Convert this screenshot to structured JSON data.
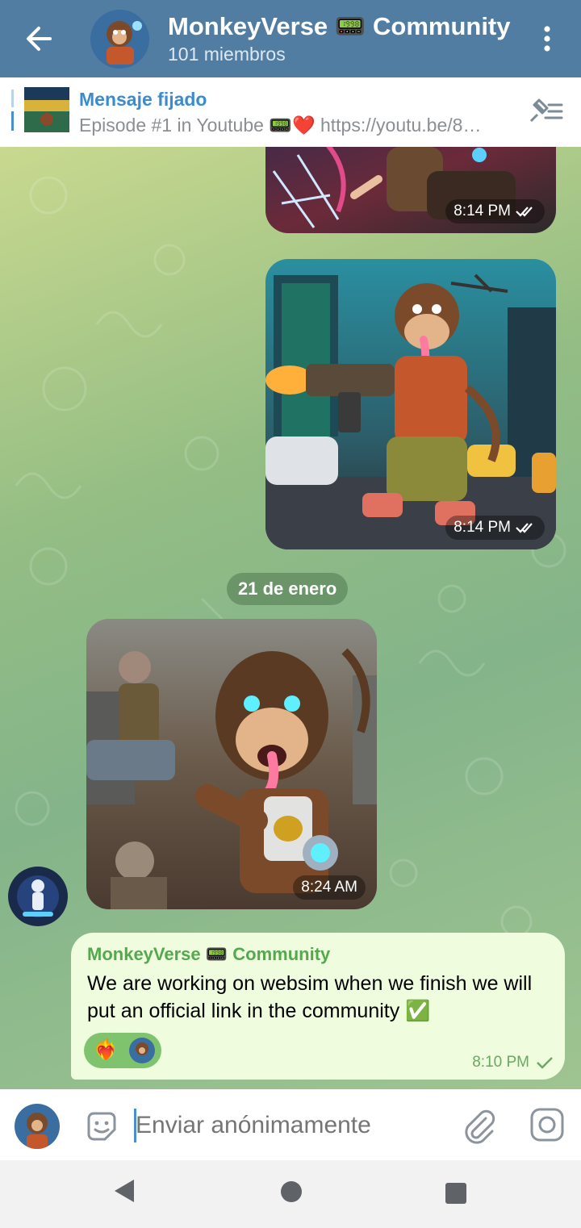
{
  "header": {
    "title": "MonkeyVerse 📟 Community",
    "subtitle": "101 miembros",
    "accent": "#517da2"
  },
  "pinned": {
    "title": "Mensaje fijado",
    "text": "Episode #1 in Youtube 📟❤️  https://youtu.be/8…"
  },
  "messages": {
    "photo1_time": "8:14 PM",
    "photo2_time": "8:14 PM",
    "date_divider": "21 de enero",
    "photo3_time": "8:24 AM",
    "text_message": {
      "sender": "MonkeyVerse 📟 Community",
      "text": "We are working on websim when we finish we will put an official link in the community ✅",
      "reaction": "❤️‍🔥",
      "time": "8:10 PM"
    }
  },
  "input": {
    "placeholder": "Enviar anónimamente"
  },
  "icons": {
    "back": "arrow-left-icon",
    "more": "more-vertical-icon",
    "unpin": "unpin-list-icon",
    "sticker": "sticker-icon",
    "attach": "paperclip-icon",
    "camera": "camera-icon",
    "read": "double-check-icon",
    "sent": "check-icon"
  }
}
